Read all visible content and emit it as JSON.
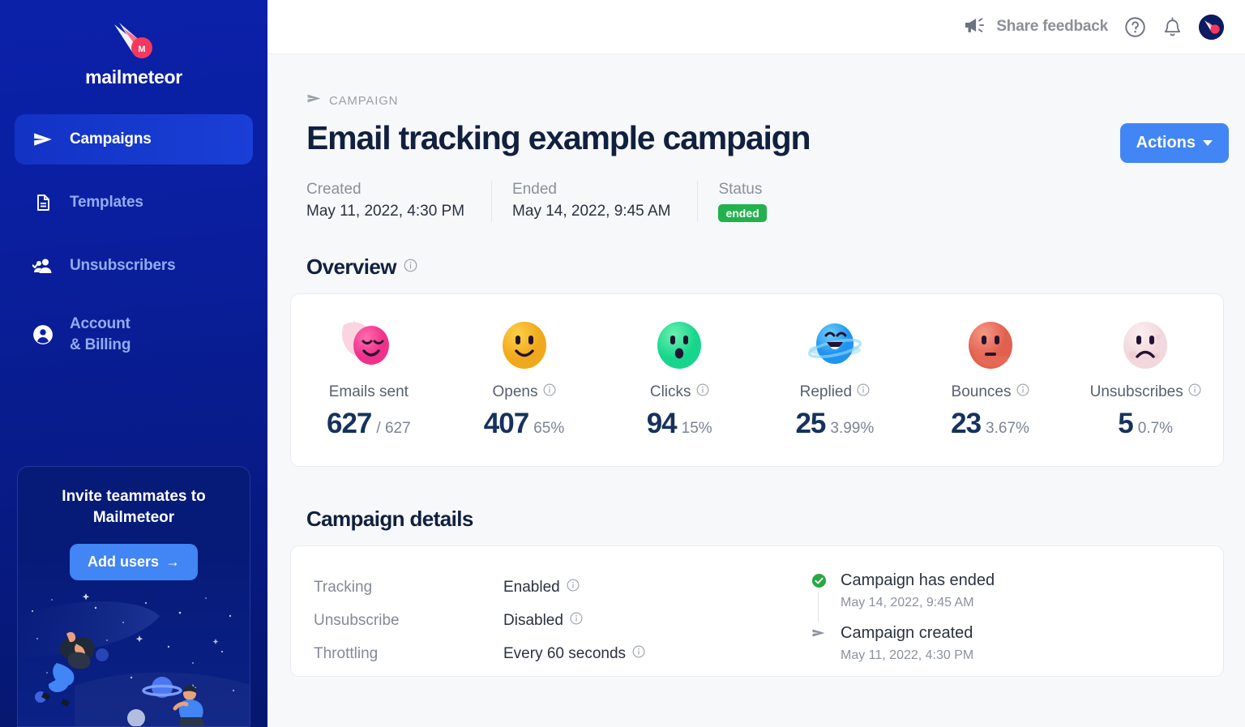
{
  "sidebar": {
    "brand": {
      "name": "mailmeteor",
      "logo_icon": "meteor-logo-icon"
    },
    "items": [
      {
        "label": "Campaigns",
        "icon": "send-icon",
        "active": true
      },
      {
        "label": "Templates",
        "icon": "document-icon",
        "active": false
      },
      {
        "label": "Unsubscribers",
        "icon": "users-check-icon",
        "active": false
      },
      {
        "label": "Account\n& Billing",
        "label_line1": "Account",
        "label_line2": "& Billing",
        "icon": "user-circle-icon",
        "active": false
      }
    ],
    "invite": {
      "title": "Invite teammates to Mailmeteor",
      "button_label": "Add users",
      "button_arrow": "→",
      "illustration": "space-illustration"
    }
  },
  "topbar": {
    "feedback_label": "Share feedback",
    "feedback_icon": "megaphone-icon",
    "help_icon": "question-circle-icon",
    "notification_icon": "bell-icon",
    "avatar_icon": "meteor-avatar-icon"
  },
  "breadcrumb": {
    "icon": "send-icon",
    "label": "CAMPAIGN"
  },
  "header": {
    "title": "Email tracking example campaign",
    "actions_label": "Actions",
    "caret_icon": "chevron-down-icon"
  },
  "meta": [
    {
      "label": "Created",
      "value": "May 11, 2022, 4:30 PM"
    },
    {
      "label": "Ended",
      "value": "May 14, 2022, 9:45 AM"
    },
    {
      "label": "Status",
      "value": "ended",
      "is_badge": true
    }
  ],
  "overview": {
    "title": "Overview",
    "info_icon": "info-icon",
    "stats": [
      {
        "emoji": "meteor-emoji",
        "label": "Emails sent",
        "has_info": false,
        "value": "627",
        "sub": "/ 627"
      },
      {
        "emoji": "smiley-emoji",
        "label": "Opens",
        "has_info": true,
        "value": "407",
        "sub": "65%"
      },
      {
        "emoji": "surprised-emoji",
        "label": "Clicks",
        "has_info": true,
        "value": "94",
        "sub": "15%"
      },
      {
        "emoji": "planet-happy-emoji",
        "label": "Replied",
        "has_info": true,
        "value": "25",
        "sub": "3.99%"
      },
      {
        "emoji": "mars-neutral-emoji",
        "label": "Bounces",
        "has_info": true,
        "value": "23",
        "sub": "3.67%"
      },
      {
        "emoji": "moon-sad-emoji",
        "label": "Unsubscribes",
        "has_info": true,
        "value": "5",
        "sub": "0.7%"
      }
    ]
  },
  "details": {
    "title": "Campaign details",
    "rows": [
      {
        "label": "Tracking",
        "value": "Enabled",
        "has_info": true
      },
      {
        "label": "Unsubscribe",
        "value": "Disabled",
        "has_info": true
      },
      {
        "label": "Throttling",
        "value": "Every 60 seconds",
        "has_info": true
      }
    ],
    "timeline": [
      {
        "marker": "check-circle-icon",
        "title": "Campaign has ended",
        "date": "May 14, 2022, 9:45 AM"
      },
      {
        "marker": "send-icon",
        "title": "Campaign created",
        "date": "May 11, 2022, 4:30 PM"
      }
    ]
  },
  "colors": {
    "accent": "#4285f4",
    "sidebar": "#0b21a8",
    "status_green": "#22b14c",
    "title": "#11203f",
    "stat_number": "#16325c"
  }
}
